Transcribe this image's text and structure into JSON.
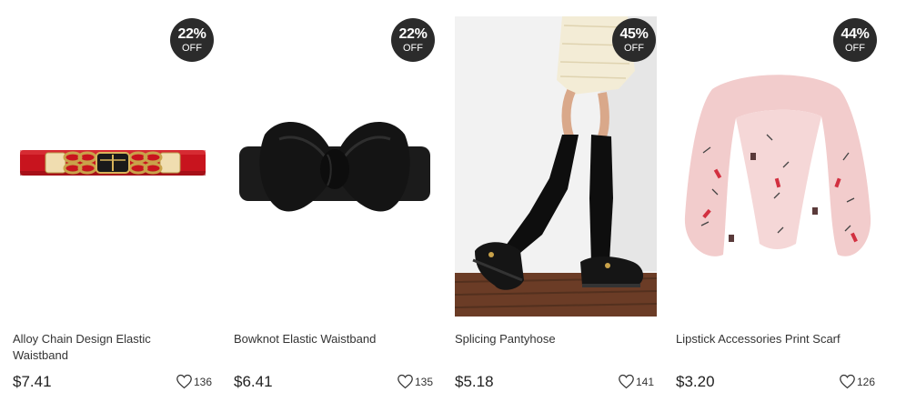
{
  "products": [
    {
      "discount_pct": "22%",
      "discount_off": "OFF",
      "title": "Alloy Chain Design Elastic Waistband",
      "price": "$7.41",
      "likes": "136",
      "image": "red-elastic-belt-gold-chain-buckle"
    },
    {
      "discount_pct": "22%",
      "discount_off": "OFF",
      "title": "Bowknot Elastic Waistband",
      "price": "$6.41",
      "likes": "135",
      "image": "black-bow-waistband"
    },
    {
      "discount_pct": "45%",
      "discount_off": "OFF",
      "title": "Splicing Pantyhose",
      "price": "$5.18",
      "likes": "141",
      "image": "black-thigh-high-pantyhose-legs"
    },
    {
      "discount_pct": "44%",
      "discount_off": "OFF",
      "title": "Lipstick Accessories Print Scarf",
      "price": "$3.20",
      "likes": "126",
      "image": "pink-printed-scarf"
    }
  ],
  "colors": {
    "badge_bg": "#2b2b2b",
    "belt_red": "#c8141e",
    "bow_black": "#151515",
    "scarf_pink": "#f2cccc"
  },
  "icons": {
    "like": "heart-outline-icon"
  }
}
